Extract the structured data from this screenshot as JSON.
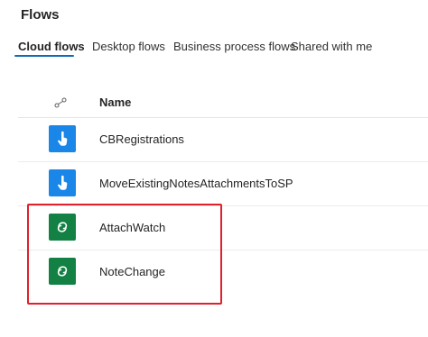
{
  "page": {
    "title": "Flows"
  },
  "tabs": [
    {
      "label": "Cloud flows",
      "active": true
    },
    {
      "label": "Desktop flows",
      "active": false
    },
    {
      "label": "Business process flows",
      "active": false
    },
    {
      "label": "Shared with me",
      "active": false
    }
  ],
  "table": {
    "type_icon": "link-icon",
    "name_header": "Name",
    "rows": [
      {
        "name": "CBRegistrations",
        "icon": "touch-icon",
        "color": "#1a86e8"
      },
      {
        "name": "MoveExistingNotesAttachmentsToSP",
        "icon": "touch-icon",
        "color": "#1a86e8"
      },
      {
        "name": "AttachWatch",
        "icon": "dataverse-icon",
        "color": "#138044"
      },
      {
        "name": "NoteChange",
        "icon": "dataverse-icon",
        "color": "#138044"
      }
    ]
  },
  "annotation": {
    "color": "#e0202a"
  }
}
